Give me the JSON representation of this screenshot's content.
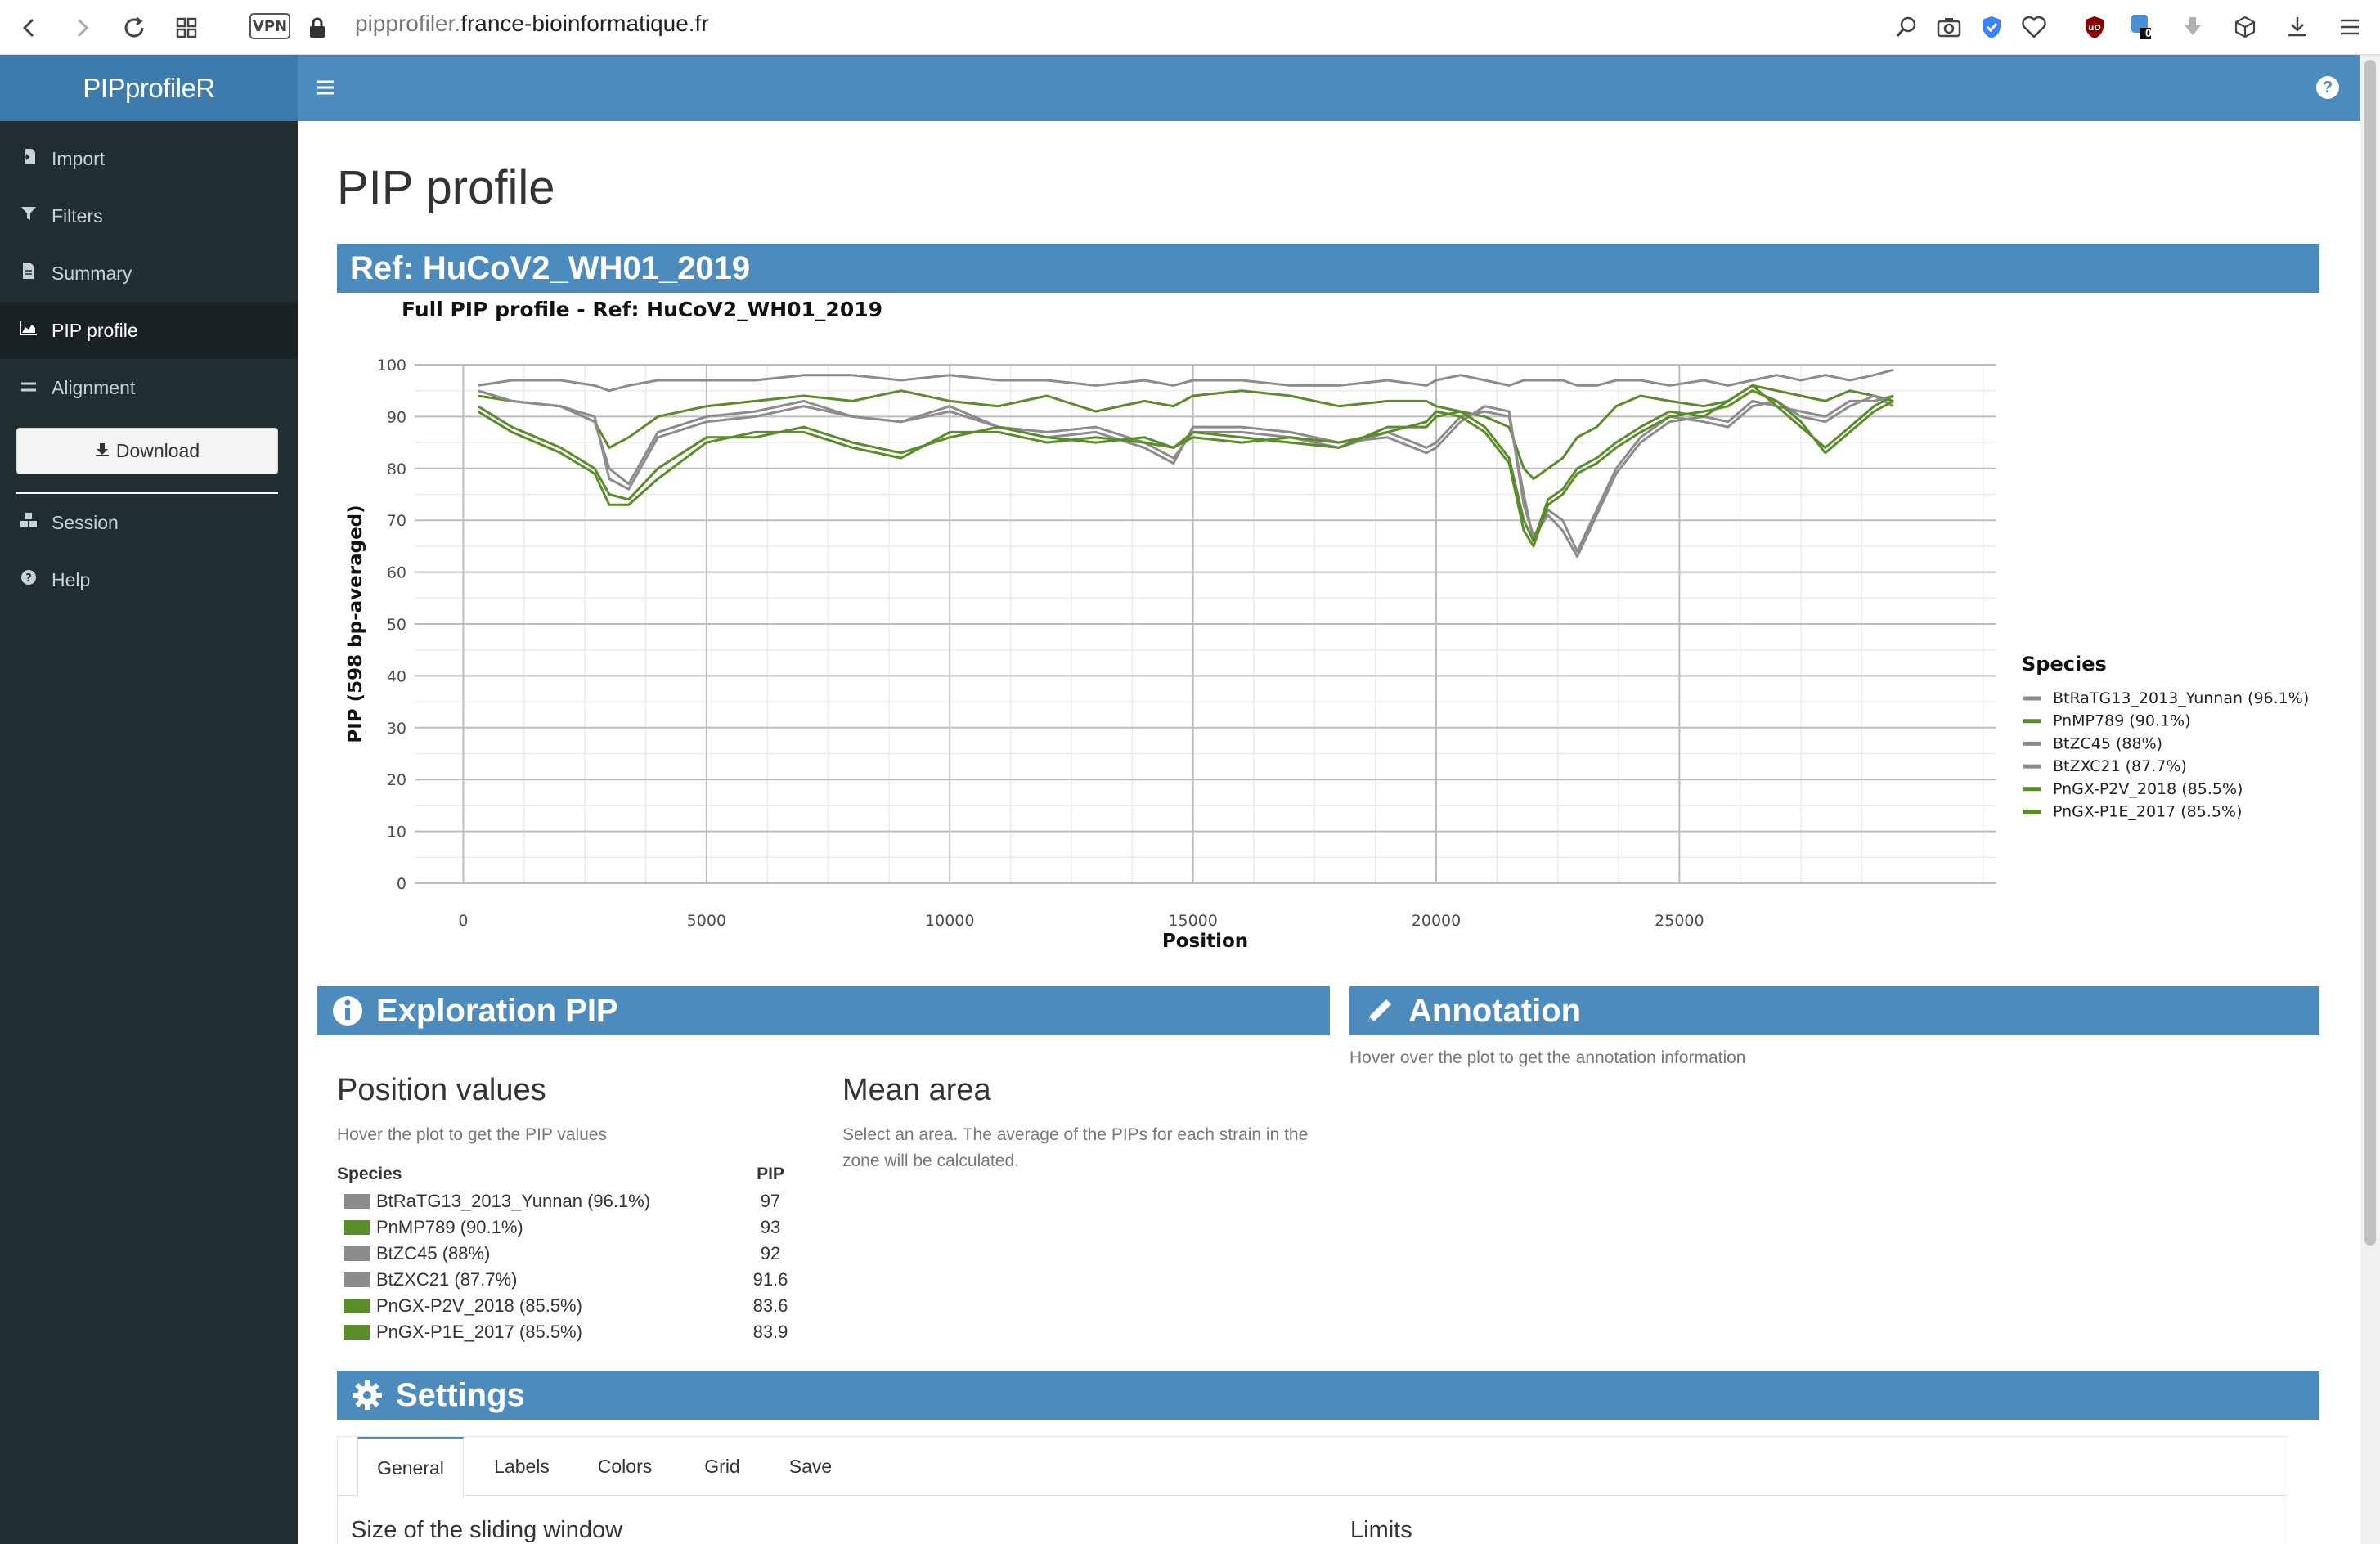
{
  "browser": {
    "url_sub": "pipprofiler.",
    "url_domain": "france-bioinformatique.fr",
    "vpn_label": "VPN",
    "badge_count": "0"
  },
  "app": {
    "brand": "PIPprofileR"
  },
  "sidebar": {
    "items": [
      {
        "label": "Import",
        "icon": "import-icon"
      },
      {
        "label": "Filters",
        "icon": "filter-icon"
      },
      {
        "label": "Summary",
        "icon": "document-icon"
      },
      {
        "label": "PIP profile",
        "icon": "area-chart-icon",
        "active": true
      },
      {
        "label": "Alignment",
        "icon": "equals-icon"
      }
    ],
    "download_label": "Download",
    "bottom_items": [
      {
        "label": "Session",
        "icon": "cubes-icon"
      },
      {
        "label": "Help",
        "icon": "question-circle-icon"
      }
    ]
  },
  "main": {
    "page_title": "PIP profile",
    "ref_header": "Ref: HuCoV2_WH01_2019",
    "exploration_header": "Exploration PIP",
    "annotation_header": "Annotation",
    "annotation_hint": "Hover over the plot to get the annotation information",
    "position_values_title": "Position values",
    "position_values_hint": "Hover the plot to get the PIP values",
    "mean_area_title": "Mean area",
    "mean_area_hint": "Select an area. The average of the PIPs for each strain in the zone will be calculated.",
    "table_header_species": "Species",
    "table_header_pip": "PIP",
    "table_rows": [
      {
        "species": "BtRaTG13_2013_Yunnan (96.1%)",
        "pip": "97",
        "color": "#8c8c8c"
      },
      {
        "species": "PnMP789 (90.1%)",
        "pip": "93",
        "color": "#5b8c2a"
      },
      {
        "species": "BtZC45 (88%)",
        "pip": "92",
        "color": "#8c8c8c"
      },
      {
        "species": "BtZXC21 (87.7%)",
        "pip": "91.6",
        "color": "#8c8c8c"
      },
      {
        "species": "PnGX-P2V_2018 (85.5%)",
        "pip": "83.6",
        "color": "#5b8c2a"
      },
      {
        "species": "PnGX-P1E_2017 (85.5%)",
        "pip": "83.9",
        "color": "#5b8c2a"
      }
    ],
    "settings_header": "Settings",
    "tabs": [
      "General",
      "Labels",
      "Colors",
      "Grid",
      "Save"
    ],
    "active_tab": "General",
    "size_window_label": "Size of the sliding window",
    "limits_label": "Limits"
  },
  "chart_data": {
    "type": "line",
    "title": "Full PIP profile - Ref: HuCoV2_WH01_2019",
    "xlabel": "Position",
    "ylabel": "PIP (598 bp-averaged)",
    "xlim": [
      -1000,
      31500
    ],
    "ylim": [
      0,
      100
    ],
    "xticks": [
      0,
      5000,
      10000,
      15000,
      20000,
      25000
    ],
    "yticks": [
      0,
      10,
      20,
      30,
      40,
      50,
      60,
      70,
      80,
      90,
      100
    ],
    "grid": true,
    "legend_title": "Species",
    "legend_position": "right",
    "x": [
      300,
      1000,
      2000,
      2700,
      3000,
      3400,
      4000,
      5000,
      6000,
      7000,
      8000,
      9000,
      10000,
      11000,
      12000,
      13000,
      14000,
      14600,
      15000,
      16000,
      17000,
      18000,
      19000,
      19800,
      20000,
      20500,
      21000,
      21500,
      21800,
      22000,
      22300,
      22600,
      22900,
      23300,
      23700,
      24200,
      24800,
      25500,
      26000,
      26500,
      27000,
      27500,
      28000,
      28500,
      29000,
      29400
    ],
    "series": [
      {
        "name": "BtRaTG13_2013_Yunnan (96.1%)",
        "color": "#8c8c8c",
        "values": [
          96,
          97,
          97,
          96,
          95,
          96,
          97,
          97,
          97,
          98,
          98,
          97,
          98,
          97,
          97,
          96,
          97,
          96,
          97,
          97,
          96,
          96,
          97,
          96,
          97,
          98,
          97,
          96,
          97,
          97,
          97,
          97,
          96,
          96,
          97,
          97,
          96,
          97,
          96,
          97,
          98,
          97,
          98,
          97,
          98,
          99
        ]
      },
      {
        "name": "PnMP789 (90.1%)",
        "color": "#5b8c2a",
        "values": [
          94,
          93,
          92,
          89,
          84,
          86,
          90,
          92,
          93,
          94,
          93,
          95,
          93,
          92,
          94,
          91,
          93,
          92,
          94,
          95,
          94,
          92,
          93,
          93,
          92,
          91,
          90,
          88,
          80,
          78,
          80,
          82,
          86,
          88,
          92,
          94,
          93,
          92,
          93,
          96,
          95,
          94,
          93,
          95,
          94,
          93
        ]
      },
      {
        "name": "BtZC45 (88%)",
        "color": "#8c8c8c",
        "values": [
          95,
          93,
          92,
          90,
          78,
          76,
          86,
          89,
          90,
          92,
          90,
          89,
          91,
          88,
          87,
          88,
          85,
          82,
          87,
          87,
          86,
          84,
          87,
          84,
          85,
          90,
          91,
          90,
          75,
          66,
          72,
          70,
          64,
          72,
          80,
          86,
          90,
          89,
          88,
          92,
          93,
          90,
          89,
          92,
          94,
          92
        ]
      },
      {
        "name": "BtZXC21 (87.7%)",
        "color": "#8c8c8c",
        "values": [
          95,
          93,
          92,
          89,
          80,
          77,
          87,
          90,
          91,
          93,
          90,
          89,
          92,
          88,
          86,
          87,
          84,
          81,
          88,
          88,
          87,
          85,
          86,
          83,
          84,
          89,
          92,
          91,
          73,
          67,
          71,
          68,
          63,
          71,
          79,
          85,
          89,
          90,
          89,
          93,
          92,
          91,
          90,
          93,
          93,
          94
        ]
      },
      {
        "name": "PnGX-P2V_2018 (85.5%)",
        "color": "#5b8c2a",
        "values": [
          92,
          88,
          84,
          80,
          75,
          74,
          80,
          86,
          86,
          88,
          85,
          83,
          86,
          88,
          86,
          85,
          86,
          84,
          87,
          86,
          85,
          84,
          88,
          88,
          90,
          91,
          88,
          82,
          70,
          66,
          74,
          76,
          80,
          82,
          85,
          88,
          91,
          90,
          93,
          96,
          92,
          88,
          84,
          88,
          92,
          94
        ]
      },
      {
        "name": "PnGX-P1E_2017 (85.5%)",
        "color": "#5b8c2a",
        "values": [
          91,
          87,
          83,
          79,
          73,
          73,
          78,
          85,
          87,
          87,
          84,
          82,
          87,
          87,
          85,
          86,
          85,
          84,
          86,
          85,
          86,
          85,
          87,
          89,
          91,
          90,
          87,
          81,
          68,
          65,
          73,
          75,
          79,
          81,
          84,
          87,
          90,
          91,
          92,
          95,
          93,
          89,
          83,
          87,
          91,
          93
        ]
      }
    ]
  }
}
